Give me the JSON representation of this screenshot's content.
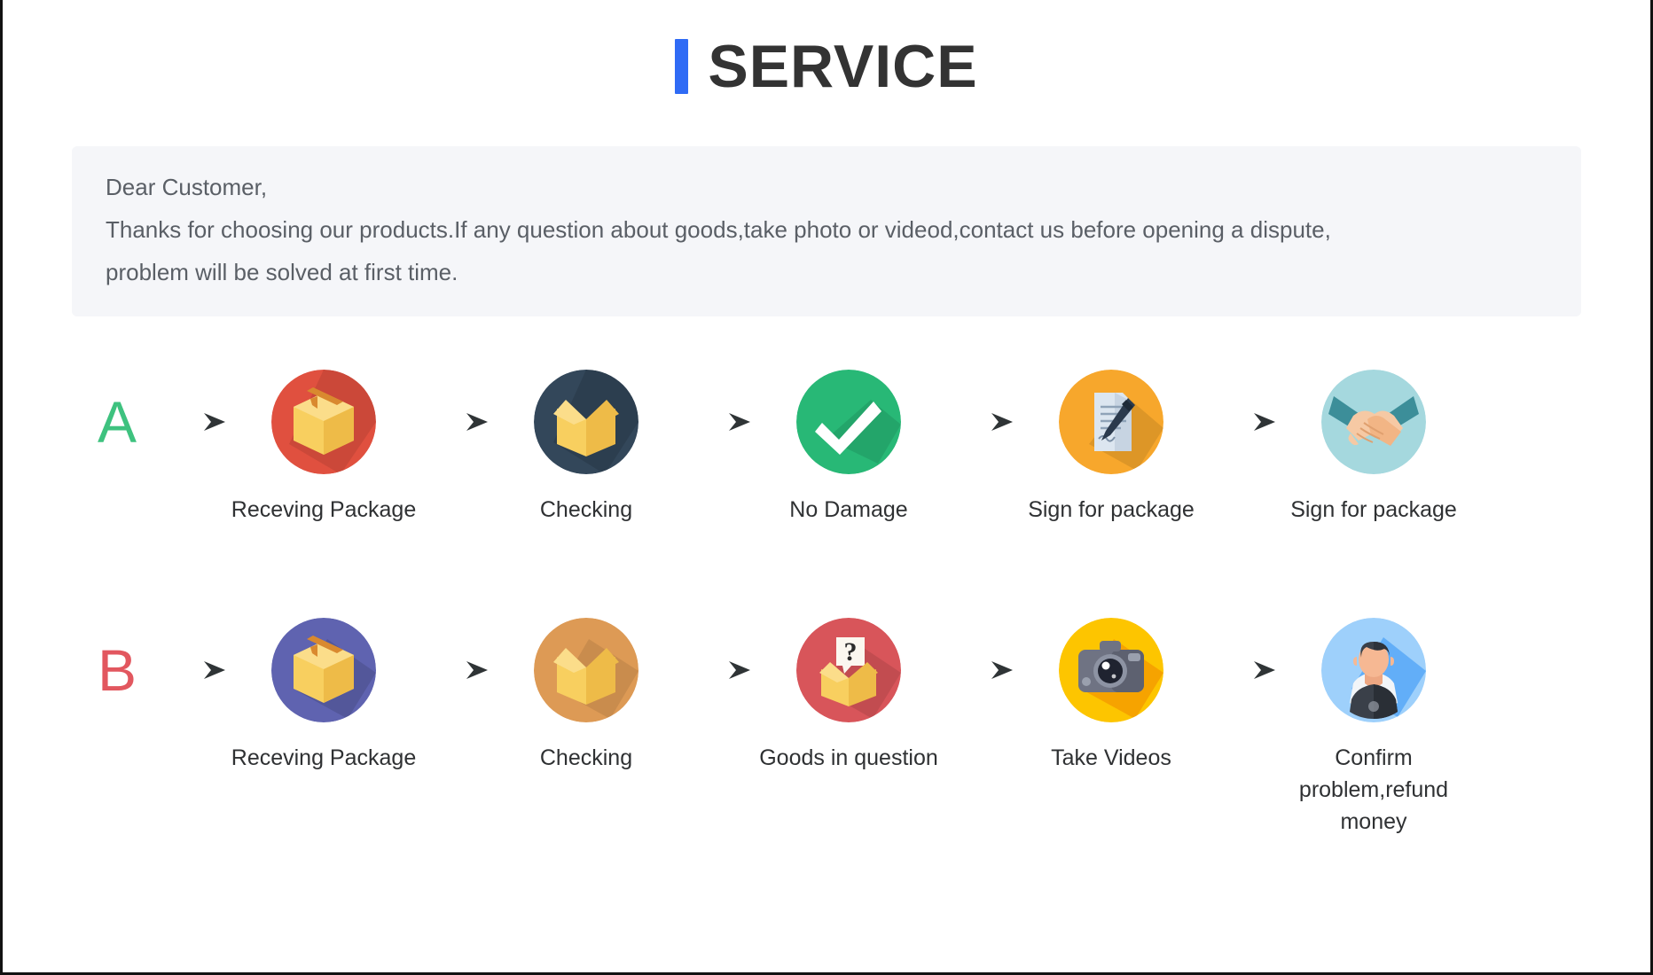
{
  "header": {
    "title": "SERVICE",
    "accent_color": "#2f6bf5",
    "title_color": "#333333"
  },
  "notice": {
    "background": "#f5f6f9",
    "lines": [
      "Dear Customer,",
      "Thanks for choosing our products.If any question about goods,take photo or videod,contact us before opening a dispute,",
      "problem will be solved at first time."
    ]
  },
  "flows": [
    {
      "letter": "A",
      "letter_color": "#3ec27f",
      "steps": [
        {
          "label": "Receving Package",
          "icon": "sealed-box-icon",
          "circle_color": "#e0503f"
        },
        {
          "label": "Checking",
          "icon": "open-box-icon",
          "circle_color": "#33475a"
        },
        {
          "label": "No Damage",
          "icon": "checkmark-icon",
          "circle_color": "#28b876"
        },
        {
          "label": "Sign for package",
          "icon": "document-pen-icon",
          "circle_color": "#f7a72c"
        },
        {
          "label": "Sign for package",
          "icon": "handshake-icon",
          "circle_color": "#a5d8de"
        }
      ]
    },
    {
      "letter": "B",
      "letter_color": "#e2575f",
      "steps": [
        {
          "label": "Receving Package",
          "icon": "sealed-box-icon",
          "circle_color": "#5f63b0"
        },
        {
          "label": "Checking",
          "icon": "open-box-icon",
          "circle_color": "#dd9a55"
        },
        {
          "label": "Goods in question",
          "icon": "question-box-icon",
          "circle_color": "#d8555a"
        },
        {
          "label": "Take Videos",
          "icon": "camera-icon",
          "circle_color": "#fdc500"
        },
        {
          "label": "Confirm problem,refund money",
          "icon": "support-agent-icon",
          "circle_color": "#9ed0fb"
        }
      ]
    }
  ],
  "arrow": {
    "name": "arrow-right-icon",
    "color": "#3d4347"
  }
}
